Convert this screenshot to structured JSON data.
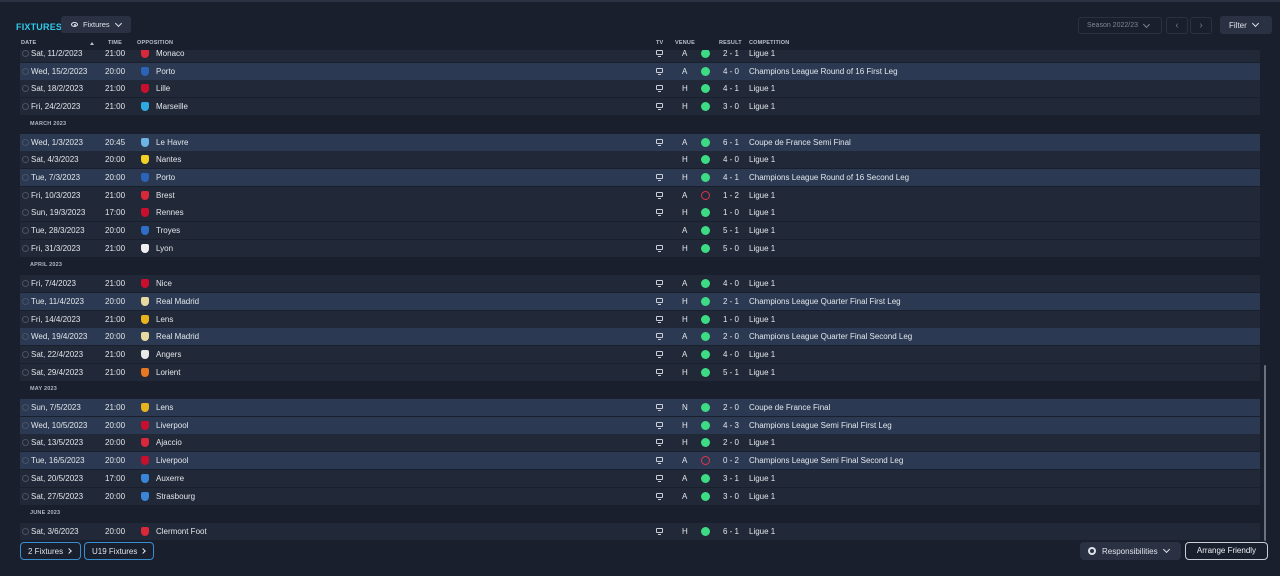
{
  "header": {
    "title": "FIXTURES",
    "view_dropdown": "Fixtures",
    "season_dropdown": "Season 2022/23",
    "prev_label": "‹",
    "next_label": "›",
    "filter_label": "Filter"
  },
  "columns": {
    "date": "DATE",
    "time": "TIME",
    "opposition": "OPPOSITION",
    "tv": "TV",
    "venue": "VENUE",
    "result": "RESULT",
    "competition": "COMPETITION"
  },
  "months": {
    "march": "MARCH 2023",
    "april": "APRIL 2023",
    "may": "MAY 2023",
    "june": "JUNE 2023"
  },
  "fixtures": [
    {
      "date": "Sat, 11/2/2023",
      "time": "21:00",
      "opposition": "Monaco",
      "venue": "A",
      "result": "2 - 1",
      "outcome": "W",
      "competition": "Ligue 1",
      "tv": true,
      "highlight": false,
      "crest_color": "#d8283a"
    },
    {
      "date": "Wed, 15/2/2023",
      "time": "20:00",
      "opposition": "Porto",
      "venue": "A",
      "result": "4 - 0",
      "outcome": "W",
      "competition": "Champions League Round of 16 First Leg",
      "tv": true,
      "highlight": true,
      "crest_color": "#2b63b8"
    },
    {
      "date": "Sat, 18/2/2023",
      "time": "21:00",
      "opposition": "Lille",
      "venue": "H",
      "result": "4 - 1",
      "outcome": "W",
      "competition": "Ligue 1",
      "tv": true,
      "highlight": false,
      "crest_color": "#c8102e"
    },
    {
      "date": "Fri, 24/2/2023",
      "time": "21:00",
      "opposition": "Marseille",
      "venue": "H",
      "result": "3 - 0",
      "outcome": "W",
      "competition": "Ligue 1",
      "tv": true,
      "highlight": false,
      "crest_color": "#2fa8e0"
    },
    {
      "date": "Wed, 1/3/2023",
      "time": "20:45",
      "opposition": "Le Havre",
      "venue": "A",
      "result": "6 - 1",
      "outcome": "W",
      "competition": "Coupe de France Semi Final",
      "tv": true,
      "highlight": true,
      "crest_color": "#6cb3e6"
    },
    {
      "date": "Sat, 4/3/2023",
      "time": "20:00",
      "opposition": "Nantes",
      "venue": "H",
      "result": "4 - 0",
      "outcome": "W",
      "competition": "Ligue 1",
      "tv": false,
      "highlight": false,
      "crest_color": "#f2d024"
    },
    {
      "date": "Tue, 7/3/2023",
      "time": "20:00",
      "opposition": "Porto",
      "venue": "H",
      "result": "4 - 1",
      "outcome": "W",
      "competition": "Champions League Round of 16 Second Leg",
      "tv": true,
      "highlight": true,
      "crest_color": "#2b63b8"
    },
    {
      "date": "Fri, 10/3/2023",
      "time": "21:00",
      "opposition": "Brest",
      "venue": "A",
      "result": "1 - 2",
      "outcome": "L",
      "competition": "Ligue 1",
      "tv": true,
      "highlight": false,
      "crest_color": "#d8283a"
    },
    {
      "date": "Sun, 19/3/2023",
      "time": "17:00",
      "opposition": "Rennes",
      "venue": "H",
      "result": "1 - 0",
      "outcome": "W",
      "competition": "Ligue 1",
      "tv": true,
      "highlight": false,
      "crest_color": "#c8102e"
    },
    {
      "date": "Tue, 28/3/2023",
      "time": "20:00",
      "opposition": "Troyes",
      "venue": "A",
      "result": "5 - 1",
      "outcome": "W",
      "competition": "Ligue 1",
      "tv": false,
      "highlight": false,
      "crest_color": "#2f6ec4"
    },
    {
      "date": "Fri, 31/3/2023",
      "time": "21:00",
      "opposition": "Lyon",
      "venue": "H",
      "result": "5 - 0",
      "outcome": "W",
      "competition": "Ligue 1",
      "tv": true,
      "highlight": false,
      "crest_color": "#f0f0f0"
    },
    {
      "date": "Fri, 7/4/2023",
      "time": "21:00",
      "opposition": "Nice",
      "venue": "A",
      "result": "4 - 0",
      "outcome": "W",
      "competition": "Ligue 1",
      "tv": true,
      "highlight": false,
      "crest_color": "#c8102e"
    },
    {
      "date": "Tue, 11/4/2023",
      "time": "20:00",
      "opposition": "Real Madrid",
      "venue": "H",
      "result": "2 - 1",
      "outcome": "W",
      "competition": "Champions League Quarter Final First Leg",
      "tv": true,
      "highlight": true,
      "crest_color": "#e8d9a0"
    },
    {
      "date": "Fri, 14/4/2023",
      "time": "21:00",
      "opposition": "Lens",
      "venue": "H",
      "result": "1 - 0",
      "outcome": "W",
      "competition": "Ligue 1",
      "tv": true,
      "highlight": false,
      "crest_color": "#e8b41e"
    },
    {
      "date": "Wed, 19/4/2023",
      "time": "20:00",
      "opposition": "Real Madrid",
      "venue": "A",
      "result": "2 - 0",
      "outcome": "W",
      "competition": "Champions League Quarter Final Second Leg",
      "tv": true,
      "highlight": true,
      "crest_color": "#e8d9a0"
    },
    {
      "date": "Sat, 22/4/2023",
      "time": "21:00",
      "opposition": "Angers",
      "venue": "A",
      "result": "4 - 0",
      "outcome": "W",
      "competition": "Ligue 1",
      "tv": true,
      "highlight": false,
      "crest_color": "#e8e8e8"
    },
    {
      "date": "Sat, 29/4/2023",
      "time": "21:00",
      "opposition": "Lorient",
      "venue": "H",
      "result": "5 - 1",
      "outcome": "W",
      "competition": "Ligue 1",
      "tv": true,
      "highlight": false,
      "crest_color": "#e87722"
    },
    {
      "date": "Sun, 7/5/2023",
      "time": "21:00",
      "opposition": "Lens",
      "venue": "N",
      "result": "2 - 0",
      "outcome": "W",
      "competition": "Coupe de France Final",
      "tv": true,
      "highlight": true,
      "crest_color": "#e8b41e"
    },
    {
      "date": "Wed, 10/5/2023",
      "time": "20:00",
      "opposition": "Liverpool",
      "venue": "H",
      "result": "4 - 3",
      "outcome": "W",
      "competition": "Champions League Semi Final First Leg",
      "tv": true,
      "highlight": true,
      "crest_color": "#c8102e"
    },
    {
      "date": "Sat, 13/5/2023",
      "time": "20:00",
      "opposition": "Ajaccio",
      "venue": "H",
      "result": "2 - 0",
      "outcome": "W",
      "competition": "Ligue 1",
      "tv": true,
      "highlight": false,
      "crest_color": "#d8283a"
    },
    {
      "date": "Tue, 16/5/2023",
      "time": "20:00",
      "opposition": "Liverpool",
      "venue": "A",
      "result": "0 - 2",
      "outcome": "L",
      "competition": "Champions League Semi Final Second Leg",
      "tv": true,
      "highlight": true,
      "crest_color": "#c8102e"
    },
    {
      "date": "Sat, 20/5/2023",
      "time": "17:00",
      "opposition": "Auxerre",
      "venue": "A",
      "result": "3 - 1",
      "outcome": "W",
      "competition": "Ligue 1",
      "tv": true,
      "highlight": false,
      "crest_color": "#3a86d6"
    },
    {
      "date": "Sat, 27/5/2023",
      "time": "20:00",
      "opposition": "Strasbourg",
      "venue": "A",
      "result": "3 - 0",
      "outcome": "W",
      "competition": "Ligue 1",
      "tv": true,
      "highlight": false,
      "crest_color": "#3a86d6"
    },
    {
      "date": "Sat, 3/6/2023",
      "time": "20:00",
      "opposition": "Clermont Foot",
      "venue": "H",
      "result": "6 - 1",
      "outcome": "W",
      "competition": "Ligue 1",
      "tv": true,
      "highlight": false,
      "crest_color": "#d8283a"
    }
  ],
  "footer": {
    "first_team_fixtures": "2 Fixtures",
    "u19_fixtures": "U19 Fixtures",
    "responsibilities": "Responsibilities",
    "arrange_friendly": "Arrange Friendly"
  }
}
